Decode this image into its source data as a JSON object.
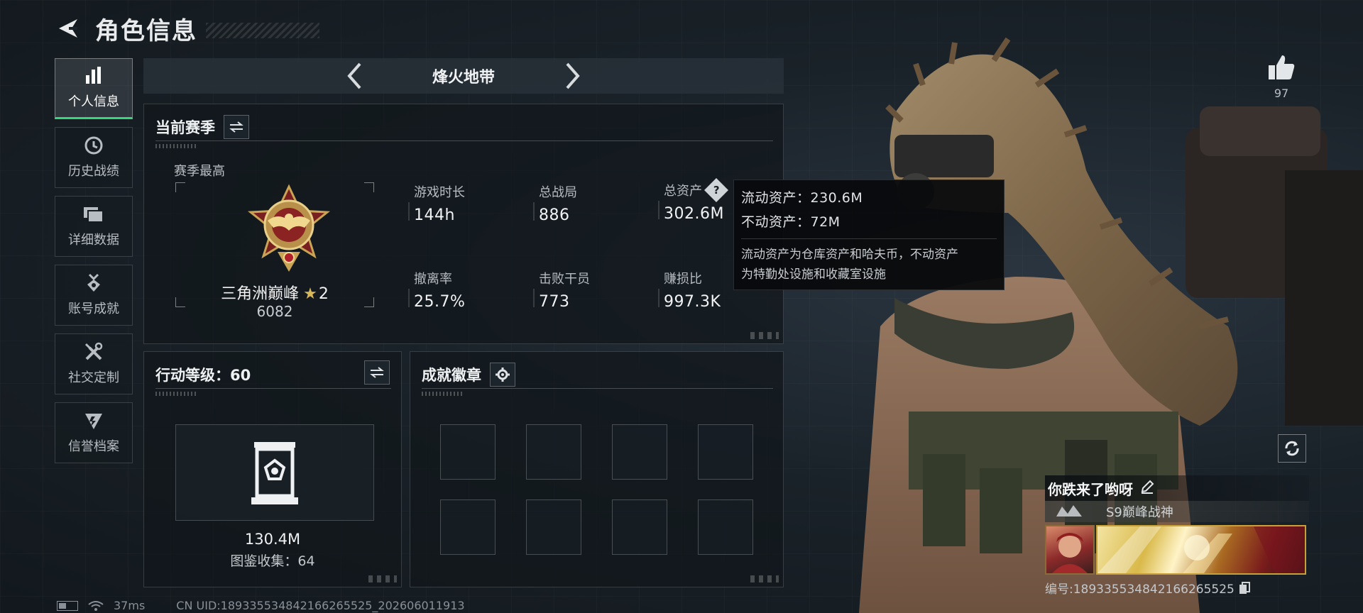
{
  "header": {
    "title": "角色信息"
  },
  "nav": {
    "items": [
      {
        "label": "个人信息",
        "icon": "bar-chart-icon"
      },
      {
        "label": "历史战绩",
        "icon": "clock-icon"
      },
      {
        "label": "详细数据",
        "icon": "folders-icon"
      },
      {
        "label": "账号成就",
        "icon": "medal-icon"
      },
      {
        "label": "社交定制",
        "icon": "tools-icon"
      },
      {
        "label": "信誉档案",
        "icon": "shield-badge-icon"
      }
    ],
    "active_index": 0
  },
  "mode": {
    "name": "烽火地带"
  },
  "season": {
    "title": "当前赛季",
    "best_label": "赛季最高",
    "rank_name": "三角洲巅峰",
    "rank_stars": "2",
    "rank_score": "6082",
    "stats": [
      {
        "label": "游戏时长",
        "value": "144h"
      },
      {
        "label": "总战局",
        "value": "886"
      },
      {
        "label": "总资产",
        "value": "302.6M",
        "has_help": true
      },
      {
        "label": "撤离率",
        "value": "25.7%"
      },
      {
        "label": "击败干员",
        "value": "773"
      },
      {
        "label": "赚损比",
        "value": "997.3K"
      }
    ]
  },
  "tooltip": {
    "liquid": "流动资产：230.6M",
    "fixed": "不动资产：72M",
    "desc_line1": "流动资产为仓库资产和哈夫币，不动资产",
    "desc_line2": "为特勤处设施和收藏室设施"
  },
  "level": {
    "title": "行动等级：60",
    "value": "130.4M",
    "collection": "图鉴收集：64"
  },
  "badges": {
    "title": "成就徽章",
    "slots": 8
  },
  "profile": {
    "likes": "97",
    "name": "你跌来了哟呀",
    "title": "S9巅峰战神",
    "id_line": "编号:18933553484216626552​5"
  },
  "status": {
    "ping": "37ms",
    "uid": "CN UID:18933553484216626552​5_202606011913"
  },
  "colors": {
    "accent_green": "#38d67a",
    "gold": "#d6b85a"
  }
}
